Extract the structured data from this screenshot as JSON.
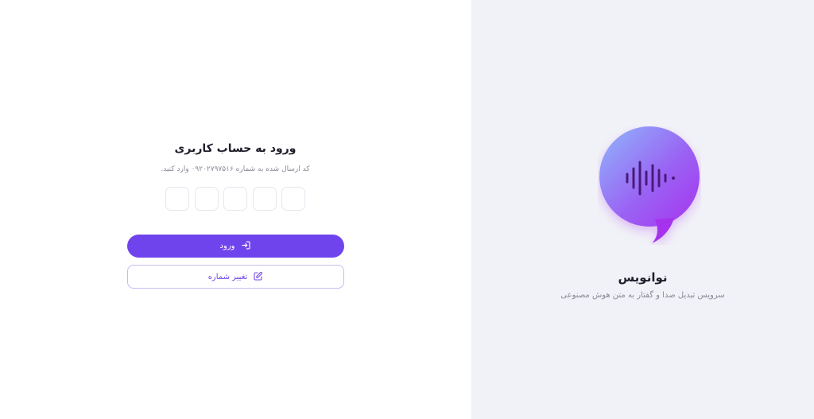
{
  "login": {
    "title": "ورود به حساب کاربری",
    "subtitle": "کد ارسال شده به شماره ۰۹۲۰۲۷۹۷۵۱۶ وارد کنید.",
    "otp_digits": [
      "",
      "",
      "",
      "",
      ""
    ],
    "submit_label": "ورود",
    "change_number_label": "تغییر شماره",
    "submit_icon": "login-enter-icon",
    "change_icon": "edit-icon"
  },
  "brand": {
    "name": "نوانویس",
    "tagline": "سرویس تبدیل صدا و گفتار به متن هوش مصنوعی",
    "logo_icon": "voice-wave-bubble-icon"
  },
  "colors": {
    "accent": "#7044ec",
    "right_panel_bg": "#f1f2f7",
    "logo_gradient_start": "#8fb8fb",
    "logo_gradient_end": "#a633ee",
    "wave_color": "#4a1a7a"
  }
}
